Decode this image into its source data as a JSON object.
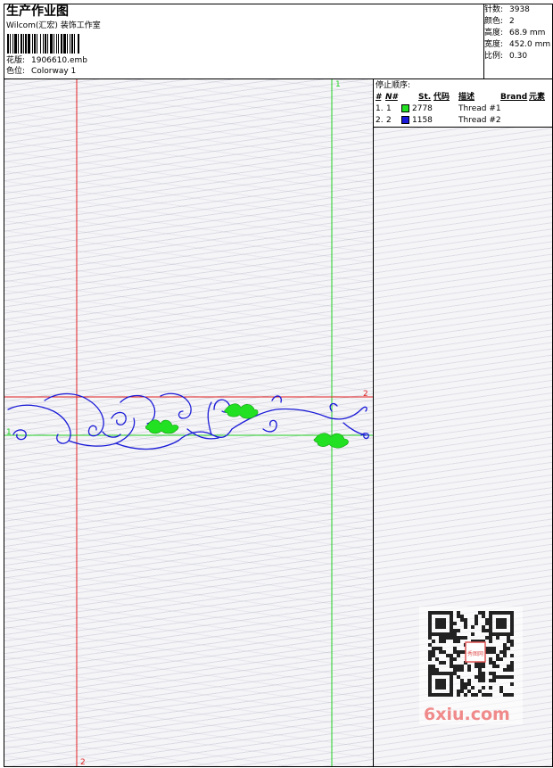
{
  "header": {
    "title": "生产作业图",
    "company": "Wilcom(汇宏) 装饰工作室",
    "design_label": "花版:",
    "design_value": "1906610.emb",
    "colorway_label": "色位:",
    "colorway_value": "Colorway 1"
  },
  "stats": [
    {
      "label": "针数:",
      "value": "3938"
    },
    {
      "label": "颜色:",
      "value": "2"
    },
    {
      "label": "高度:",
      "value": "68.9 mm"
    },
    {
      "label": "宽度:",
      "value": "452.0 mm"
    },
    {
      "label": "比例:",
      "value": "0.30"
    }
  ],
  "stop_sequence": {
    "title": "停止顺序:",
    "columns": [
      "#",
      "N#",
      "St.",
      "代码",
      "描述",
      "Brand",
      "元素"
    ],
    "rows": [
      {
        "index": "1.",
        "n": "1",
        "color": "#22e022",
        "stitches": "2778",
        "desc": "Thread #1"
      },
      {
        "index": "2.",
        "n": "2",
        "color": "#1a1ad8",
        "stitches": "1158",
        "desc": "Thread #2"
      }
    ]
  },
  "guides": {
    "green_vertical_label": "1",
    "red_horizontal_label": "2",
    "green_horizontal_label": "1",
    "red_vertical_label": "2"
  },
  "colors": {
    "thread1": "#22e022",
    "thread2": "#1a1ad8",
    "guide_red": "#e02020",
    "guide_green": "#20d020"
  },
  "watermark": {
    "text": "6xiu.com",
    "badge": "秀图网"
  }
}
